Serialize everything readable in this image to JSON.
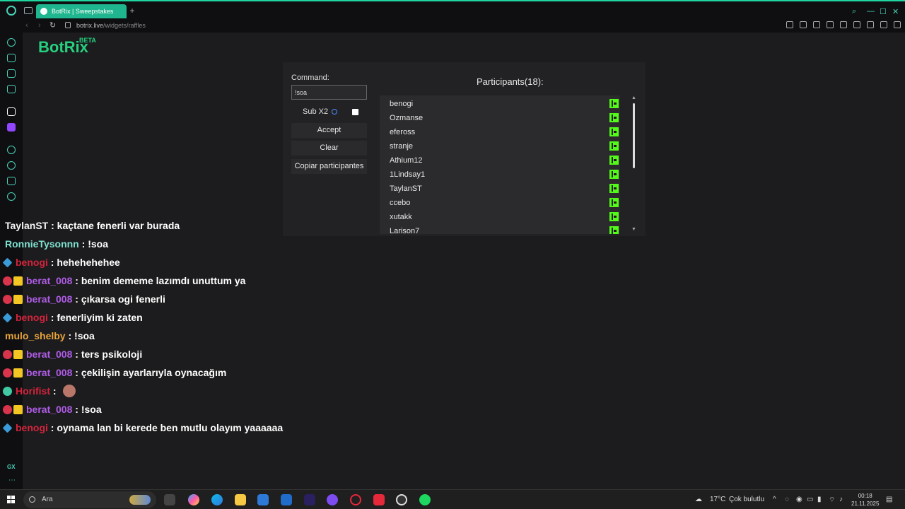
{
  "browser": {
    "tab_title": "BotRix | Sweepstakes",
    "url_host": "botrix.live",
    "url_path": "/widgets/raffles"
  },
  "page": {
    "brand": "BotRix",
    "beta": "BETA",
    "command_label": "Command:",
    "command_value": "!soa",
    "sub_label": "Sub X2",
    "sub_checked": true,
    "accept_button": "Accept",
    "clear_button": "Clear",
    "copy_button": "Copiar participantes",
    "participants_title": "Participants(18):",
    "participants": [
      "benogi",
      "Ozmanse",
      "efeross",
      "stranje",
      "Athium12",
      "1Lindsay1",
      "TaylanST",
      "ccebo",
      "xutakk",
      "Larison7"
    ],
    "platform_icon": "kick-icon"
  },
  "chat": [
    {
      "badges": [],
      "user": "TaylanST",
      "user_color": "#f4f4f4",
      "message": "kaçtane fenerli var burada"
    },
    {
      "badges": [],
      "user": "RonnieTysonnn",
      "user_color": "#7fe0d0",
      "message": "!soa"
    },
    {
      "badges": [
        "cube"
      ],
      "user": "benogi",
      "user_color": "#d4243c",
      "message": "hehehehehee"
    },
    {
      "badges": [
        "devil",
        "crown"
      ],
      "user": "berat_008",
      "user_color": "#b05ce8",
      "message": "benim dememe lazımdı unuttum ya"
    },
    {
      "badges": [
        "devil",
        "crown"
      ],
      "user": "berat_008",
      "user_color": "#b05ce8",
      "message": "çıkarsa ogi fenerli"
    },
    {
      "badges": [
        "cube"
      ],
      "user": "benogi",
      "user_color": "#d4243c",
      "message": "fenerliyim ki zaten"
    },
    {
      "badges": [],
      "user": "mulo_shelby",
      "user_color": "#e8a33c",
      "message": "!soa"
    },
    {
      "badges": [
        "devil",
        "crown"
      ],
      "user": "berat_008",
      "user_color": "#b05ce8",
      "message": "ters psikoloji"
    },
    {
      "badges": [
        "devil",
        "crown"
      ],
      "user": "berat_008",
      "user_color": "#b05ce8",
      "message": "çekilişin ayarlarıyla oynacağım"
    },
    {
      "badges": [
        "green"
      ],
      "user": "Horifist",
      "user_color": "#d4243c",
      "message": "",
      "emote": true
    },
    {
      "badges": [
        "devil",
        "crown"
      ],
      "user": "berat_008",
      "user_color": "#b05ce8",
      "message": "!soa"
    },
    {
      "badges": [
        "cube"
      ],
      "user": "benogi",
      "user_color": "#d4243c",
      "message": "oynama lan bi kerede ben mutlu olayım yaaaaaa"
    }
  ],
  "taskbar": {
    "search_placeholder": "Ara",
    "weather_temp": "17°C",
    "weather_desc": "Çok bulutlu",
    "time": "00:18",
    "date": "21.11.2025"
  }
}
